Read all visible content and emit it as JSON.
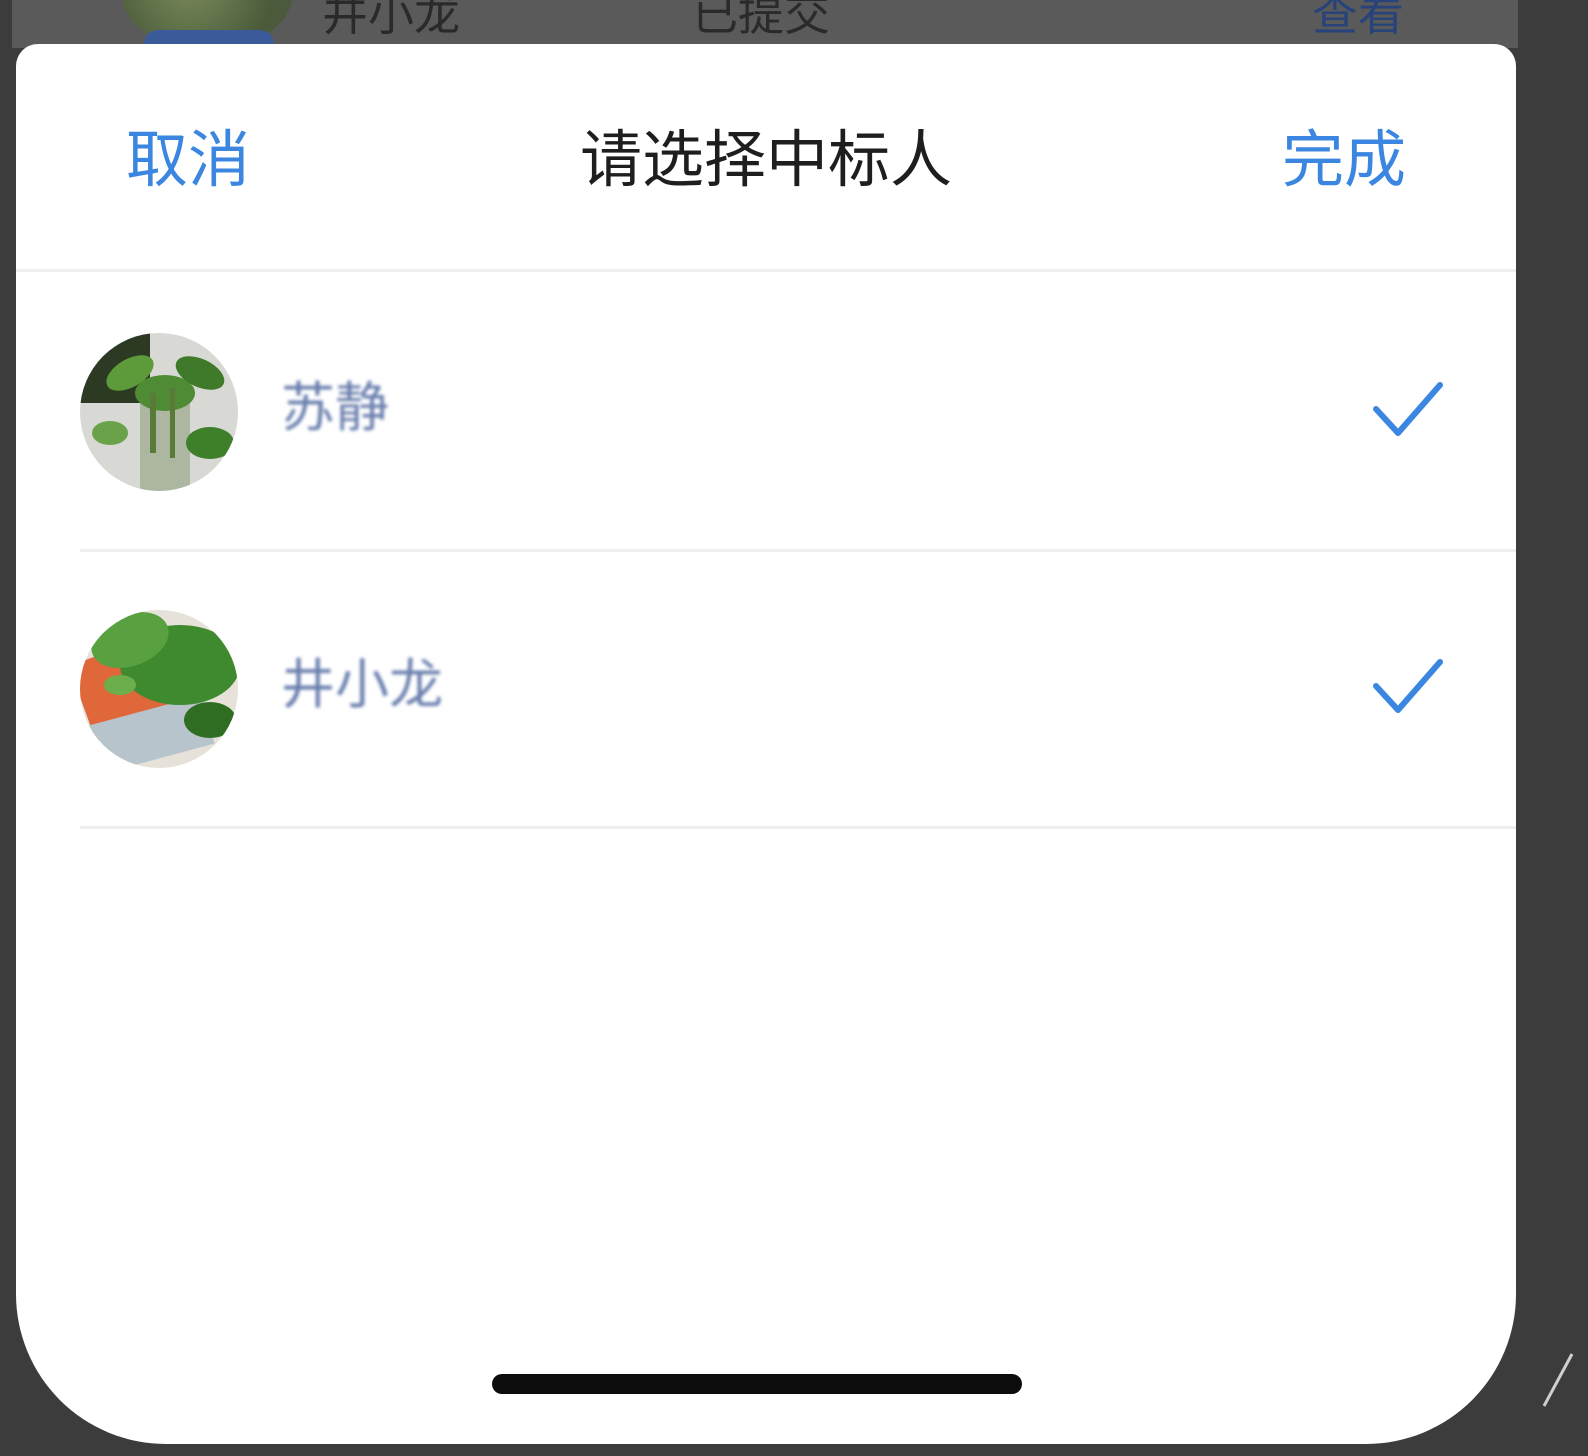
{
  "background_row": {
    "name": "井小龙",
    "status": "已提交",
    "action": "查看"
  },
  "sheet": {
    "cancel_label": "取消",
    "title": "请选择中标人",
    "done_label": "完成"
  },
  "items": [
    {
      "name": "苏静",
      "avatar_icon": "avatar-plant-vase",
      "selected": true
    },
    {
      "name": "井小龙",
      "avatar_icon": "avatar-plant-leaves",
      "selected": true
    }
  ],
  "colors": {
    "accent": "#3b86e0",
    "name_text": "#6a7fae",
    "title_text": "#1e1e1e"
  }
}
